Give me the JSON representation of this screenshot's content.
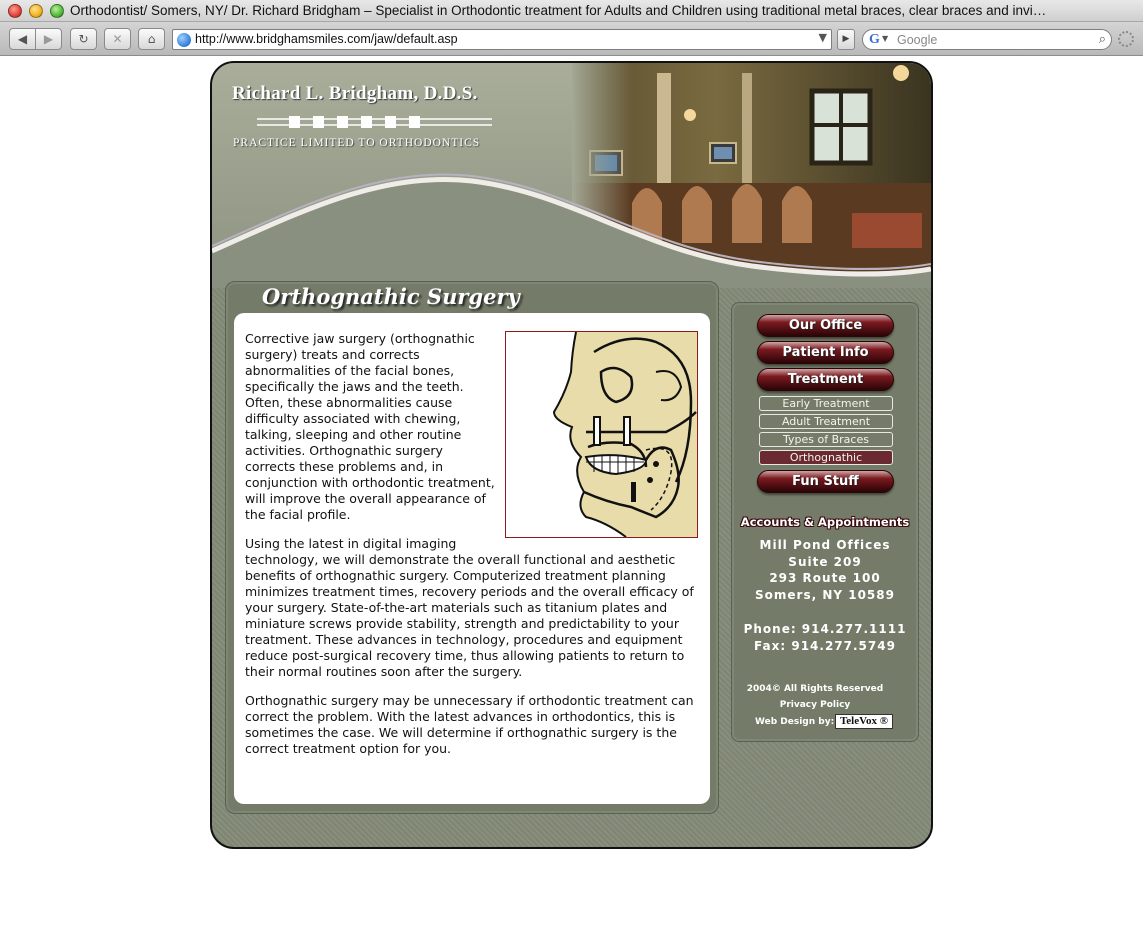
{
  "window": {
    "title": "Orthodontist/ Somers, NY/ Dr. Richard Bridgham – Specialist in Orthodontic treatment for Adults and Children using traditional metal braces, clear braces and invi…"
  },
  "toolbar": {
    "back": "◀",
    "forward": "▶",
    "reload": "↻",
    "stop": "✕",
    "home": "⌂",
    "url": "http://www.bridghamsmiles.com/jaw/default.asp",
    "search_placeholder": "Google"
  },
  "header": {
    "name": "Richard L. Bridgham, D.D.S.",
    "tagline": "PRACTICE LIMITED TO ORTHODONTICS"
  },
  "content": {
    "title": "Orthognathic Surgery",
    "paragraphs": [
      "Corrective jaw surgery (orthognathic surgery) treats and corrects abnormalities of the facial bones, specifically the jaws and the teeth. Often, these abnormalities cause difficulty associated with chewing, talking, sleeping and other routine activities. Orthognathic surgery corrects these problems and, in conjunction with orthodontic treatment, will improve the overall appearance of the facial profile.",
      "Using the latest in digital imaging technology, we will demonstrate the overall functional and aesthetic benefits of orthognathic surgery. Computerized treatment planning minimizes treatment times, recovery periods and the overall efficacy of your surgery. State-of-the-art materials such as titanium plates and miniature screws provide stability, strength and predictability to your treatment. These advances in technology, procedures and equipment reduce post-surgical recovery time, thus allowing patients to return to their normal routines soon after the surgery.",
      "Orthognathic surgery may be unnecessary if orthodontic treatment can correct the problem. With the latest advances in orthodontics, this is sometimes the case. We will determine if orthognathic surgery is the correct treatment option for you."
    ]
  },
  "nav": {
    "our_office": "Our Office",
    "patient_info": "Patient Info",
    "treatment": "Treatment",
    "sub": [
      "Early Treatment",
      "Adult Treatment",
      "Types of Braces",
      "Orthognathic"
    ],
    "fun_stuff": "Fun Stuff"
  },
  "contact": {
    "heading": "Accounts & Appointments",
    "address": [
      "Mill Pond Offices",
      "Suite 209",
      "293 Route 100",
      "Somers, NY 10589"
    ],
    "phone": "Phone: 914.277.1111",
    "fax": "Fax: 914.277.5749"
  },
  "footer": {
    "rights": "2004© All Rights Reserved",
    "privacy": "Privacy Policy",
    "design_by": "Web Design by:",
    "designer": "TeleVox ®"
  },
  "colors": {
    "frame": "#848a78",
    "panel": "#747c69",
    "button_dark_red": "#4a0c10",
    "active_sub": "#6a2a2f"
  }
}
